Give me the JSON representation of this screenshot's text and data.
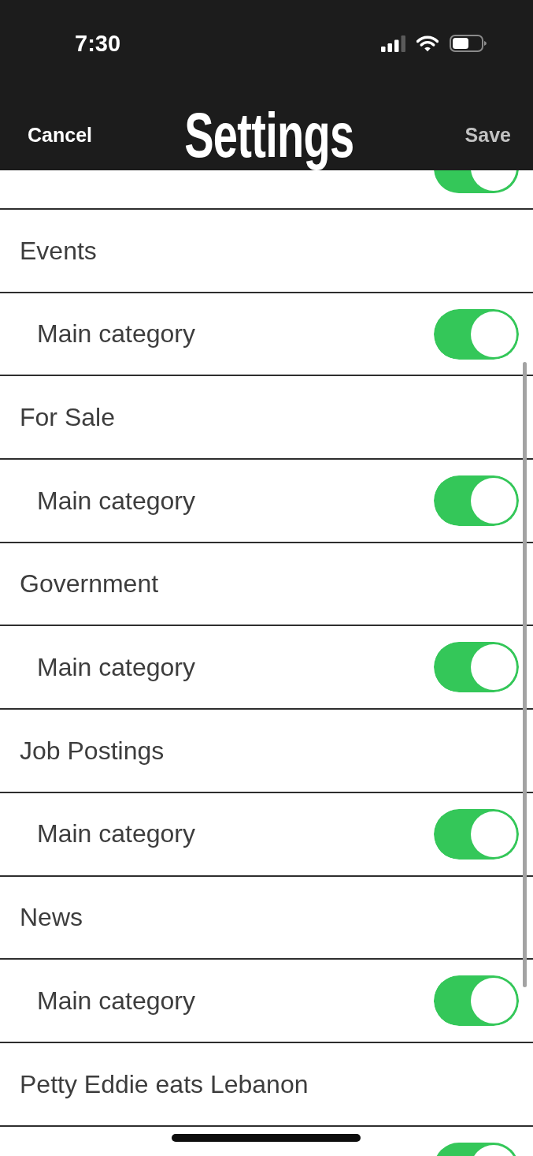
{
  "status_bar": {
    "time": "7:30"
  },
  "nav_bar": {
    "cancel": {
      "label": "Cancel",
      "disabled": false
    },
    "title": "Settings",
    "save": {
      "label": "Save",
      "disabled": true
    }
  },
  "rows": [
    {
      "kind": "toggle",
      "on": true
    },
    {
      "kind": "section",
      "label": "Events"
    },
    {
      "kind": "toggle",
      "label": "Main category",
      "on": true
    },
    {
      "kind": "section",
      "label": "For Sale"
    },
    {
      "kind": "toggle",
      "label": "Main category",
      "on": true
    },
    {
      "kind": "section",
      "label": "Government"
    },
    {
      "kind": "toggle",
      "label": "Main category",
      "on": true
    },
    {
      "kind": "section",
      "label": "Job Postings"
    },
    {
      "kind": "toggle",
      "label": "Main category",
      "on": true
    },
    {
      "kind": "section",
      "label": "News"
    },
    {
      "kind": "toggle",
      "label": "Main category",
      "on": true
    },
    {
      "kind": "section",
      "label": "Petty Eddie eats Lebanon"
    },
    {
      "kind": "toggle",
      "on": true
    }
  ]
}
